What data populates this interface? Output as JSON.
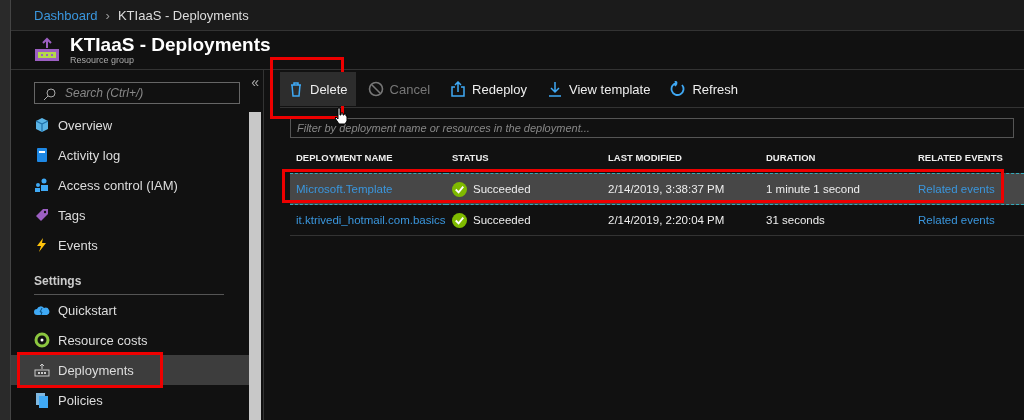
{
  "breadcrumb": {
    "items": [
      {
        "label": "Dashboard",
        "link": true
      },
      {
        "label": "KTIaaS - Deployments",
        "link": false
      }
    ],
    "separator": "›"
  },
  "header": {
    "title": "KTIaaS - Deployments",
    "subtitle": "Resource group"
  },
  "sidebar": {
    "search": {
      "placeholder": "Search (Ctrl+/)"
    },
    "collapse": "«",
    "items": [
      {
        "label": "Overview",
        "selected": false,
        "highlighted": false
      },
      {
        "label": "Activity log",
        "selected": false,
        "highlighted": false
      },
      {
        "label": "Access control (IAM)",
        "selected": false,
        "highlighted": false
      },
      {
        "label": "Tags",
        "selected": false,
        "highlighted": false
      },
      {
        "label": "Events",
        "selected": false,
        "highlighted": false
      }
    ],
    "section": "Settings",
    "settings_items": [
      {
        "label": "Quickstart",
        "selected": false,
        "highlighted": false
      },
      {
        "label": "Resource costs",
        "selected": false,
        "highlighted": false
      },
      {
        "label": "Deployments",
        "selected": true,
        "highlighted": true
      },
      {
        "label": "Policies",
        "selected": false,
        "highlighted": false
      }
    ]
  },
  "toolbar": [
    {
      "label": "Delete",
      "disabled": false,
      "highlighted": true
    },
    {
      "label": "Cancel",
      "disabled": true,
      "highlighted": false
    },
    {
      "label": "Redeploy",
      "disabled": false,
      "highlighted": false
    },
    {
      "label": "View template",
      "disabled": false,
      "highlighted": false
    },
    {
      "label": "Refresh",
      "disabled": false,
      "highlighted": false
    }
  ],
  "filter": {
    "placeholder": "Filter by deployment name or resources in the deployment..."
  },
  "table": {
    "columns": [
      "DEPLOYMENT NAME",
      "STATUS",
      "LAST MODIFIED",
      "DURATION",
      "RELATED EVENTS"
    ],
    "rows": [
      {
        "name": "Microsoft.Template",
        "status": "Succeeded",
        "last_modified": "2/14/2019, 3:38:37 PM",
        "duration": "1 minute 1 second",
        "related": "Related events",
        "selected": true,
        "highlighted": true
      },
      {
        "name": "it.ktrivedi_hotmail.com.basics",
        "status": "Succeeded",
        "last_modified": "2/14/2019, 2:20:04 PM",
        "duration": "31 seconds",
        "related": "Related events",
        "selected": false,
        "highlighted": false
      }
    ]
  }
}
